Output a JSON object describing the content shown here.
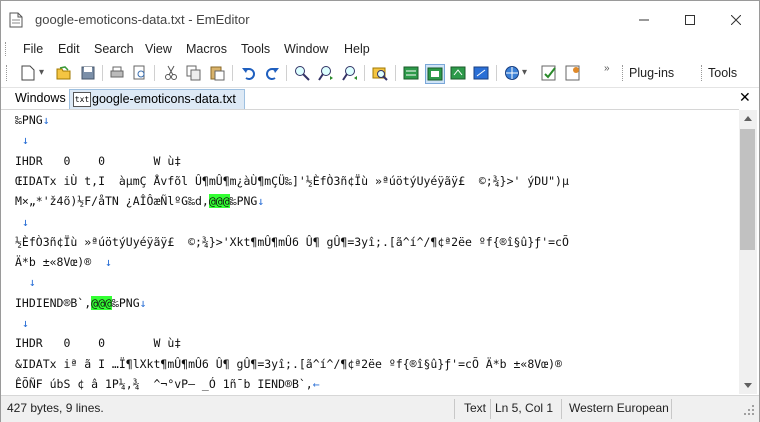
{
  "window": {
    "title": "google-emoticons-data.txt - EmEditor"
  },
  "menu": [
    "File",
    "Edit",
    "Search",
    "View",
    "Macros",
    "Tools",
    "Window",
    "Help"
  ],
  "toolbar": {
    "plugins_label": "Plug-ins",
    "tools_label": "Tools",
    "buttons": [
      "new-icon",
      "open-icon",
      "save-icon",
      "print-icon",
      "print-preview-icon",
      "cut-icon",
      "copy-icon",
      "paste-icon",
      "undo-icon",
      "redo-icon",
      "find-icon",
      "find-next-icon",
      "find-prev-icon",
      "find-in-files-icon",
      "view-1-icon",
      "view-2-icon",
      "view-3-icon",
      "view-4-icon",
      "encoding-icon",
      "properties-icon",
      "customize-icon"
    ]
  },
  "tabs": {
    "windows_label": "Windows",
    "active_tab": "google-emoticons-data.txt",
    "tab_icon_text": "txt"
  },
  "editor": {
    "lines": [
      [
        {
          "t": "‰PNG"
        },
        {
          "t": "↓",
          "c": "eol"
        }
      ],
      [
        {
          "t": " "
        },
        {
          "t": "↓",
          "c": "eol"
        }
      ],
      [
        {
          "t": "IHDR   0    0       W ù‡"
        }
      ],
      [
        {
          "t": "ŒIDATx iÙ t,I  àµmÇ Åvfõl Û¶mÛ¶m¿àÙ¶mÇÜ‰]'½ÈfÒ3ñ¢Ïù »ªúötýUyéÿãÿ£  ©;¾}>' ýDU\")µ"
        }
      ],
      [
        {
          "t": "M×„*'ž4õ)½F/åTN ¿AÎÔæÑlºG‰d,"
        },
        {
          "t": "@@@",
          "c": "hl"
        },
        {
          "t": "‰PNG"
        },
        {
          "t": "↓",
          "c": "eol"
        }
      ],
      [
        {
          "t": " "
        },
        {
          "t": "↓",
          "c": "eol"
        }
      ],
      [
        {
          "t": "½ÈfÒ3ñ¢Ïù »ªúötýUyéÿãÿ£  ©;¾}>'Xkt¶mÛ¶mÛ6 Û¶ gÛ¶=3yî;.[ã^í^/¶¢ª2ëe ºf{®î§û}ƒ'=cÕ"
        }
      ],
      [
        {
          "t": "Ä*b ±«8Vœ)®  "
        },
        {
          "t": "↓",
          "c": "eol"
        }
      ],
      [
        {
          "t": "  "
        },
        {
          "t": "↓",
          "c": "eol"
        }
      ],
      [
        {
          "t": "IHDIEND®B`,"
        },
        {
          "t": "@@@",
          "c": "hl"
        },
        {
          "t": "‰PNG"
        },
        {
          "t": "↓",
          "c": "eol"
        }
      ],
      [
        {
          "t": " "
        },
        {
          "t": "↓",
          "c": "eol"
        }
      ],
      [
        {
          "t": "IHDR   0    0       W ù‡"
        }
      ],
      [
        {
          "t": "&IDATx iª ã I …Ï¶lXkt¶mÛ¶mÛ6 Û¶ gÛ¶=3yî;.[ã^í^/¶¢ª2ëe ºf{®î§û}ƒ'=cÕ Ä*b ±«8Vœ)®"
        }
      ],
      [
        {
          "t": "ÊÕÑF úbS ¢ â 1P¼,¾  ^¬°vP— _Ó 1ñ¯b IEND®B`,"
        },
        {
          "t": "←",
          "c": "eol"
        }
      ]
    ]
  },
  "status": {
    "info": "427 bytes, 9 lines.",
    "mode": "Text",
    "position": "Ln 5, Col 1",
    "encoding": "Western European"
  }
}
